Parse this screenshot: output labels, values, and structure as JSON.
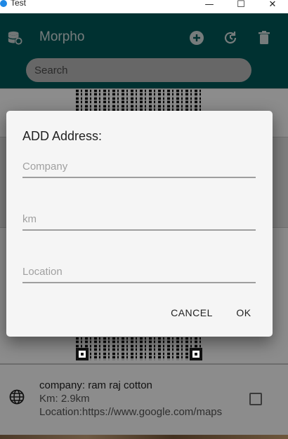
{
  "window": {
    "title": "Test",
    "minimize_glyph": "—",
    "maximize_glyph": "☐",
    "close_glyph": "✕"
  },
  "appbar": {
    "title": "Morpho",
    "icons": [
      "database-icon",
      "add-icon",
      "refresh-icon",
      "delete-icon"
    ],
    "background": "#005a5a"
  },
  "search": {
    "placeholder": "Search",
    "value": ""
  },
  "dialog": {
    "title": "ADD Address:",
    "fields": [
      {
        "placeholder": "Company",
        "value": ""
      },
      {
        "placeholder": "km",
        "value": ""
      },
      {
        "placeholder": "Location",
        "value": ""
      }
    ],
    "cancel_label": "CANCEL",
    "ok_label": "OK"
  },
  "list_item": {
    "icon": "globe-icon",
    "company": "company: ram raj cotton",
    "km": "Km: 2.9km",
    "location": "Location:https://www.google.com/maps"
  },
  "colors": {
    "accent": "#005a5a",
    "dialog_bg": "#f5f5f5"
  }
}
